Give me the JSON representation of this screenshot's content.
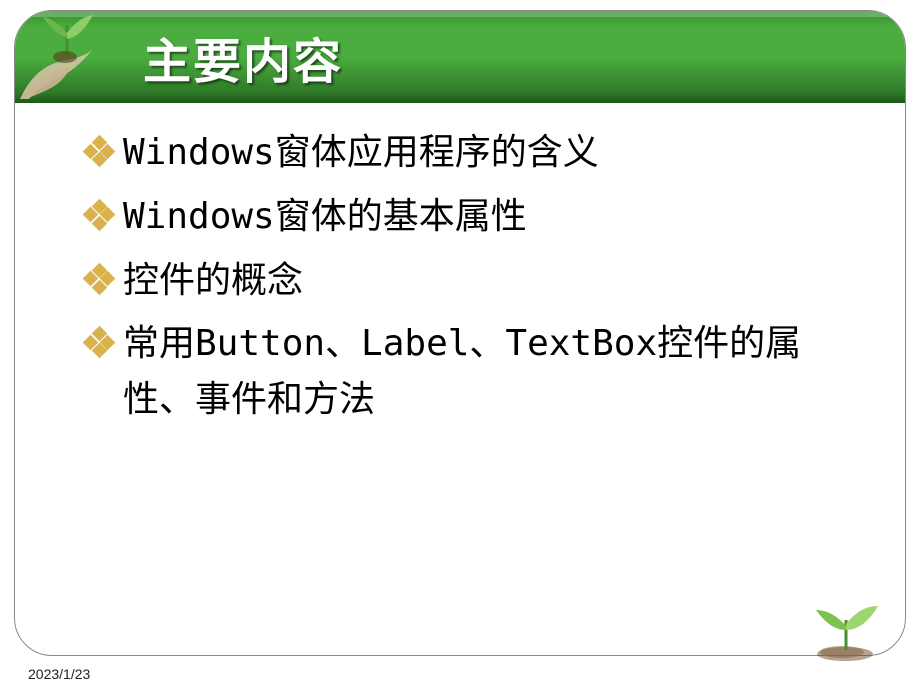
{
  "slide": {
    "title": "主要内容",
    "bullets": [
      "Windows窗体应用程序的含义",
      "Windows窗体的基本属性",
      "控件的概念",
      "常用Button、Label、TextBox控件的属性、事件和方法"
    ]
  },
  "footer": {
    "date": "2023/1/23"
  }
}
